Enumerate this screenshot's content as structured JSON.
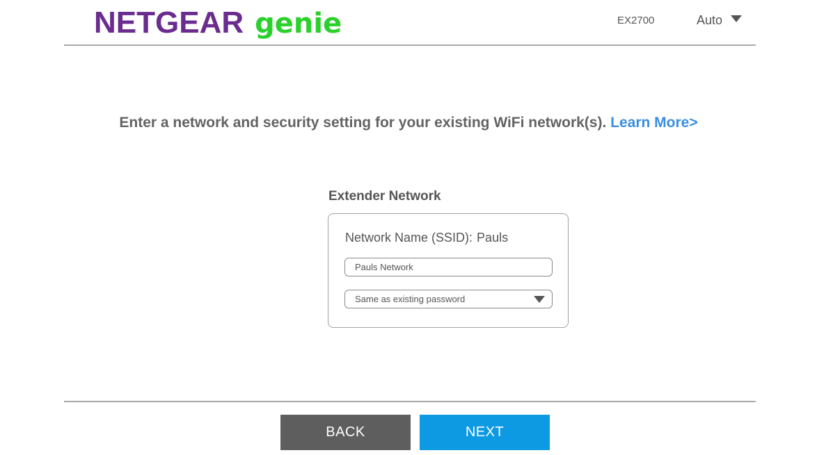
{
  "header": {
    "brand": "NETGEAR",
    "product": "genie",
    "model": "EX2700",
    "language": "Auto",
    "language_icon": "caret-down-icon"
  },
  "instruction": {
    "text": "Enter a network and security setting for your existing WiFi network(s). ",
    "link": "Learn More>"
  },
  "extender": {
    "title": "Extender Network",
    "ssid_label": "Network Name (SSID):",
    "ssid_value": "Pauls",
    "name_field_value": "Pauls Network",
    "password_option": "Same as existing password",
    "password_icon": "caret-down-icon"
  },
  "buttons": {
    "back": "BACK",
    "next": "NEXT"
  },
  "colors": {
    "brand_purple": "#6a2c8e",
    "genie_green": "#2bd02b",
    "link_blue": "#3a8ee0",
    "next_blue": "#0d9ae3",
    "back_gray": "#5e5e5e"
  }
}
